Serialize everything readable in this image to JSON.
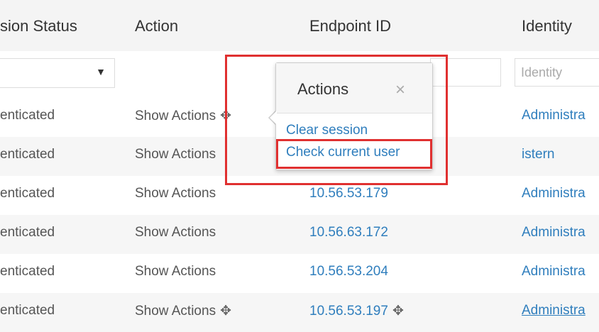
{
  "header": {
    "col_status": "sion Status",
    "col_action": "Action",
    "col_endpoint": "Endpoint ID",
    "col_identity": "Identity"
  },
  "filters": {
    "status_select_arrow": "▼",
    "identity_placeholder": "Identity"
  },
  "rows": [
    {
      "status": "enticated",
      "action": "Show Actions",
      "endpoint": "",
      "identity": "Administra"
    },
    {
      "status": "enticated",
      "action": "Show Actions",
      "endpoint": "",
      "identity": "istern"
    },
    {
      "status": "enticated",
      "action": "Show Actions",
      "endpoint": "10.56.53.179",
      "identity": "Administra"
    },
    {
      "status": "enticated",
      "action": "Show Actions",
      "endpoint": "10.56.63.172",
      "identity": "Administra"
    },
    {
      "status": "enticated",
      "action": "Show Actions",
      "endpoint": "10.56.53.204",
      "identity": "Administra"
    },
    {
      "status": "enticated",
      "action": "Show Actions",
      "endpoint": "10.56.53.197",
      "identity": "Administra"
    }
  ],
  "icons": {
    "move": "✥",
    "close": "×"
  },
  "popover": {
    "title": "Actions",
    "items": [
      "Clear session",
      "Check current user"
    ]
  },
  "colors": {
    "link": "#2f7ebd",
    "highlight": "#e03030"
  }
}
